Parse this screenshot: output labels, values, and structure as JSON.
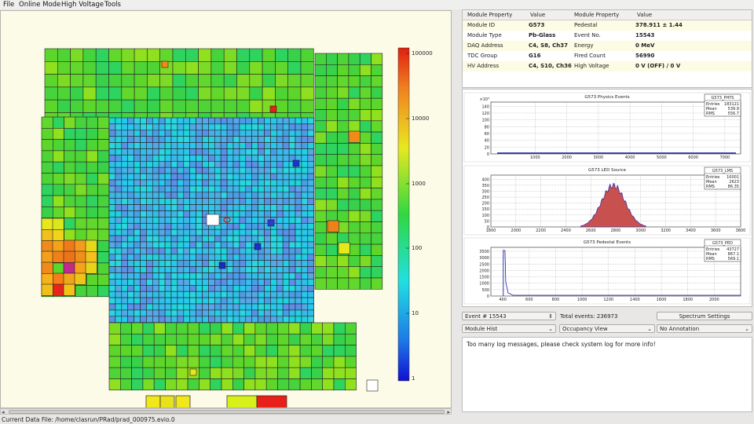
{
  "menu": [
    {
      "label": "File"
    },
    {
      "label": "Online Mode"
    },
    {
      "label": "High Voltage"
    },
    {
      "label": "Tools"
    }
  ],
  "colorbar": {
    "labels": [
      "100000",
      "10000",
      "1000",
      "100",
      "10",
      "1"
    ]
  },
  "properties": {
    "headers": [
      "Module Property",
      "Value",
      "Module Property",
      "Value"
    ],
    "rows": [
      [
        "Module ID",
        "G573",
        "Pedestal",
        "378.911 ± 1.44"
      ],
      [
        "Module Type",
        "Pb-Glass",
        "Event No.",
        "15543"
      ],
      [
        "DAQ Address",
        "C4, S8, Ch37",
        "Energy",
        "0 MeV"
      ],
      [
        "TDC Group",
        "G16",
        "Fired Count",
        "56990"
      ],
      [
        "HV Address",
        "C4, S10, Ch36",
        "High Voltage",
        "0 V (OFF) / 0 V"
      ]
    ]
  },
  "histograms": [
    {
      "title": "G573 Physics Events",
      "name": "G573_PHYS",
      "entries": "183121",
      "mean": "539.9",
      "rms": "556.7",
      "scale_note": "×10³",
      "x_ticks": [
        "1000",
        "2000",
        "3000",
        "4000",
        "5000",
        "6000",
        "7000"
      ],
      "y_ticks": [
        "0",
        "20",
        "40",
        "60",
        "80",
        "100",
        "120",
        "140"
      ]
    },
    {
      "title": "G573 LED Source",
      "name": "G573_LMS",
      "entries": "10001",
      "mean": "2623",
      "rms": "86.35",
      "x_ticks": [
        "1800",
        "2000",
        "2200",
        "2400",
        "2600",
        "2800",
        "3000",
        "3200",
        "3400",
        "3600",
        "3800"
      ],
      "y_ticks": [
        "0",
        "50",
        "100",
        "150",
        "200",
        "250",
        "300",
        "350",
        "400"
      ]
    },
    {
      "title": "G573 Pedestal Events",
      "name": "G573_PED",
      "entries": "43727",
      "mean": "867.1",
      "rms": "569.1",
      "x_ticks": [
        "400",
        "600",
        "800",
        "1000",
        "1200",
        "1400",
        "1600",
        "1800",
        "2000"
      ],
      "y_ticks": [
        "0",
        "500",
        "1000",
        "1500",
        "2000",
        "2500",
        "3000",
        "3500"
      ]
    }
  ],
  "controls": {
    "event_spin": "Event # 15543",
    "total_events": "Total events: 236973",
    "spectrum_button": "Spectrum Settings",
    "hist_select": "Module Hist",
    "view_select": "Occupancy View",
    "annotation_select": "No Annotation"
  },
  "log_message": "Too many log messages, please check system log for more info!",
  "status": "Current Data File: /home/clasrun/PRad/prad_000975.evio.0",
  "colors": {
    "panel_bg": "#fcfbe8",
    "hist_fill": "#c8504f",
    "hist_line": "#1a1aa8"
  }
}
